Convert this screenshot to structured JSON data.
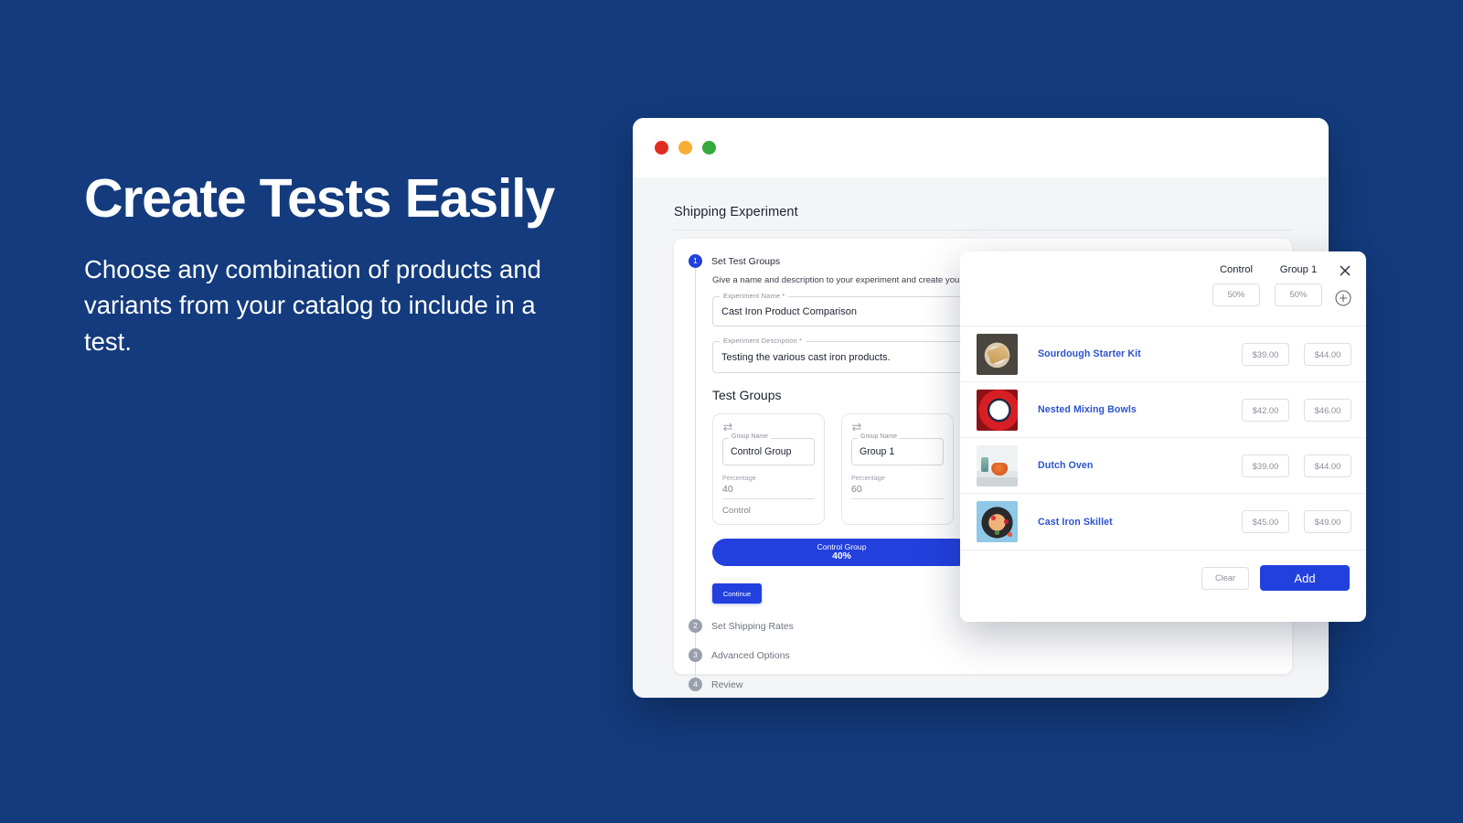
{
  "theme": {
    "background": "#133b7d",
    "accent": "#2240dd",
    "link": "#2b52cf",
    "muted": "#8a9099"
  },
  "marketing": {
    "headline": "Create Tests Easily",
    "subcopy": "Choose any combination of products and variants from your catalog to include in a test."
  },
  "window": {
    "traffic_lights": [
      "close",
      "minimize",
      "maximize"
    ],
    "page_title": "Shipping Experiment"
  },
  "wizard": {
    "steps": [
      {
        "number": "1",
        "label": "Set Test Groups",
        "active": true
      },
      {
        "number": "2",
        "label": "Set Shipping Rates",
        "active": false
      },
      {
        "number": "3",
        "label": "Advanced Options",
        "active": false
      },
      {
        "number": "4",
        "label": "Review",
        "active": false
      }
    ],
    "helper_text": "Give a name and description to your experiment and create your test",
    "fields": {
      "experiment_name": {
        "legend": "Experiment Name *",
        "value": "Cast Iron Product Comparison"
      },
      "experiment_description": {
        "legend": "Experiment Description *",
        "value": "Testing the various cast iron products."
      }
    },
    "test_groups_heading": "Test Groups",
    "groups": [
      {
        "swap_icon": "swap-arrows-icon",
        "name_legend": "Group Name",
        "name": "Control Group",
        "percentage_label": "Percentage",
        "percentage": "40",
        "sub_label": "Control"
      },
      {
        "swap_icon": "swap-arrows-icon",
        "name_legend": "Group Name",
        "name": "Group 1",
        "percentage_label": "Percentage",
        "percentage": "60",
        "sub_label": ""
      }
    ],
    "distribution_bar": {
      "name": "Control Group",
      "percent": "40%"
    },
    "continue_label": "Continue"
  },
  "modal": {
    "close_icon": "close-icon",
    "add_column_icon": "plus-circle-icon",
    "columns": [
      {
        "label": "Control",
        "allocation": "50%"
      },
      {
        "label": "Group 1",
        "allocation": "50%"
      }
    ],
    "products": [
      {
        "thumb": "sourdough-bread-thumb",
        "name": "Sourdough Starter Kit",
        "prices": [
          "$39.00",
          "$44.00"
        ]
      },
      {
        "thumb": "nested-bowls-thumb",
        "name": "Nested Mixing Bowls",
        "prices": [
          "$42.00",
          "$46.00"
        ]
      },
      {
        "thumb": "dutch-oven-thumb",
        "name": "Dutch Oven",
        "prices": [
          "$39.00",
          "$44.00"
        ]
      },
      {
        "thumb": "cast-iron-skillet-thumb",
        "name": "Cast Iron Skillet",
        "prices": [
          "$45.00",
          "$49.00"
        ]
      }
    ],
    "footer": {
      "clear_label": "Clear",
      "add_label": "Add"
    }
  }
}
